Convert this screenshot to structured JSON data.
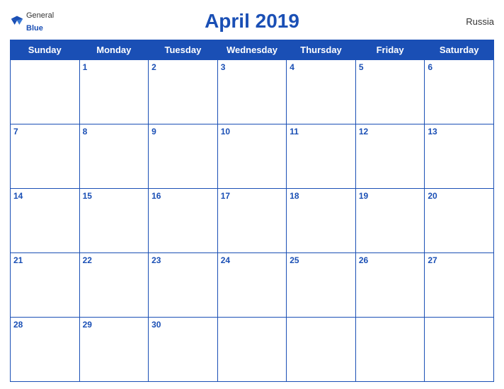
{
  "header": {
    "logo_general": "General",
    "logo_blue": "Blue",
    "title": "April 2019",
    "country": "Russia"
  },
  "days_of_week": [
    "Sunday",
    "Monday",
    "Tuesday",
    "Wednesday",
    "Thursday",
    "Friday",
    "Saturday"
  ],
  "weeks": [
    [
      null,
      1,
      2,
      3,
      4,
      5,
      6
    ],
    [
      7,
      8,
      9,
      10,
      11,
      12,
      13
    ],
    [
      14,
      15,
      16,
      17,
      18,
      19,
      20
    ],
    [
      21,
      22,
      23,
      24,
      25,
      26,
      27
    ],
    [
      28,
      29,
      30,
      null,
      null,
      null,
      null
    ]
  ]
}
